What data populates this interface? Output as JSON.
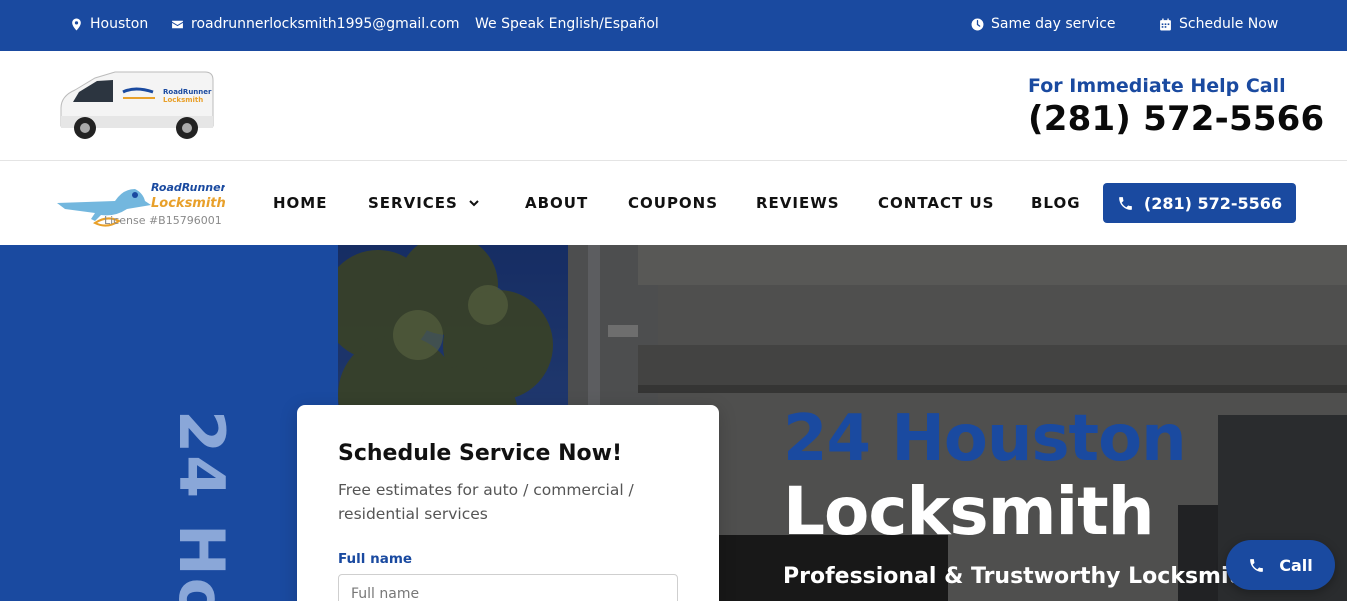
{
  "topbar": {
    "location": "Houston",
    "email": "roadrunnerlocksmith1995@gmail.com",
    "languages": "We Speak English/Español",
    "same_day": "Same day service",
    "schedule": "Schedule Now"
  },
  "header": {
    "help_label": "For Immediate Help Call",
    "help_phone": "(281) 572-5566",
    "van_logo_text_1": "RoadRunner",
    "van_logo_text_2": "Locksmith"
  },
  "nav": {
    "logo_line_1": "RoadRunner",
    "logo_line_2": "Locksmith",
    "license": "License #B15796001",
    "items": {
      "home": "HOME",
      "services": "SERVICES",
      "about": "ABOUT",
      "coupons": "COUPONS",
      "reviews": "REVIEWS",
      "contact": "CONTACT US",
      "blog": "BLOG"
    },
    "cta_phone": "(281) 572-5566"
  },
  "hero": {
    "vertical_text": "24 Ho",
    "title_line_1": "24 Houston",
    "title_line_2": "Locksmith",
    "subtitle": "Professional & Trustworthy Locksmith"
  },
  "form": {
    "title": "Schedule Service Now!",
    "description": "Free estimates for auto / commercial / residential services",
    "name_label": "Full name",
    "name_placeholder": "Full name"
  },
  "float_call": {
    "label": "Call"
  },
  "colors": {
    "brand_blue": "#1a4aa0",
    "light_blue": "#8aa7d8",
    "accent_orange": "#e8a02a"
  }
}
